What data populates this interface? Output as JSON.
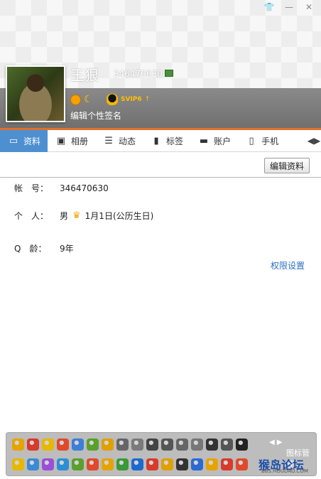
{
  "window": {
    "controls": [
      {
        "name": "skin-icon",
        "glyph": "👕"
      },
      {
        "name": "minimize-icon",
        "glyph": "—"
      },
      {
        "name": "close-icon",
        "glyph": "✕"
      }
    ]
  },
  "profile": {
    "name": "王狠",
    "qq_number": "346470630",
    "signature": "编辑个性签名",
    "svip_label": "SVIP6",
    "svip_arrow": "↑"
  },
  "tabs": [
    {
      "label": "资料",
      "icon": "profile-card-icon",
      "glyph": "▭",
      "active": true
    },
    {
      "label": "相册",
      "icon": "album-icon",
      "glyph": "▣",
      "active": false
    },
    {
      "label": "动态",
      "icon": "feed-icon",
      "glyph": "☰",
      "active": false
    },
    {
      "label": "标签",
      "icon": "bookmark-icon",
      "glyph": "▮",
      "active": false
    },
    {
      "label": "账户",
      "icon": "briefcase-icon",
      "glyph": "▬",
      "active": false
    },
    {
      "label": "手机",
      "icon": "phone-icon",
      "glyph": "▯",
      "active": false
    }
  ],
  "actions": {
    "edit_profile": "编辑资料",
    "permission_settings": "权限设置"
  },
  "fields": [
    {
      "label": "帐　号：",
      "value": "346470630"
    },
    {
      "label": "个　人：",
      "gender": "男",
      "birthday": "1月1日(公历生日)"
    },
    {
      "label": "Q　龄：",
      "value": "9年"
    }
  ],
  "emoji_bar": {
    "nav": "◀ ▶",
    "manage_label": "图标管理",
    "watermark_main": "猴岛论坛",
    "watermark_sub": "BBS.HOUDAO.COM",
    "row1_colors": [
      "#e6a400",
      "#d83a2c",
      "#e6b800",
      "#e04a2a",
      "#3b7fd6",
      "#5aa02c",
      "#e0a000",
      "#666666",
      "#7a7a7a",
      "#444444",
      "#555555",
      "#666666",
      "#777777",
      "#333333",
      "#555555",
      "#222222"
    ],
    "row2_colors": [
      "#e6b800",
      "#3b8ad6",
      "#9b4fd6",
      "#2c8fd6",
      "#5aa02c",
      "#e04a2a",
      "#e6a400",
      "#3a9a3a",
      "#1c6ad0",
      "#d83a2c",
      "#e0a000",
      "#333333",
      "#2c6ad0",
      "#e6a400",
      "#d83a2c",
      "#e04a2a"
    ]
  },
  "colors": {
    "accent_orange": "#e0702a",
    "tab_active": "#4e8fd0",
    "link_blue": "#2a6fbf"
  }
}
